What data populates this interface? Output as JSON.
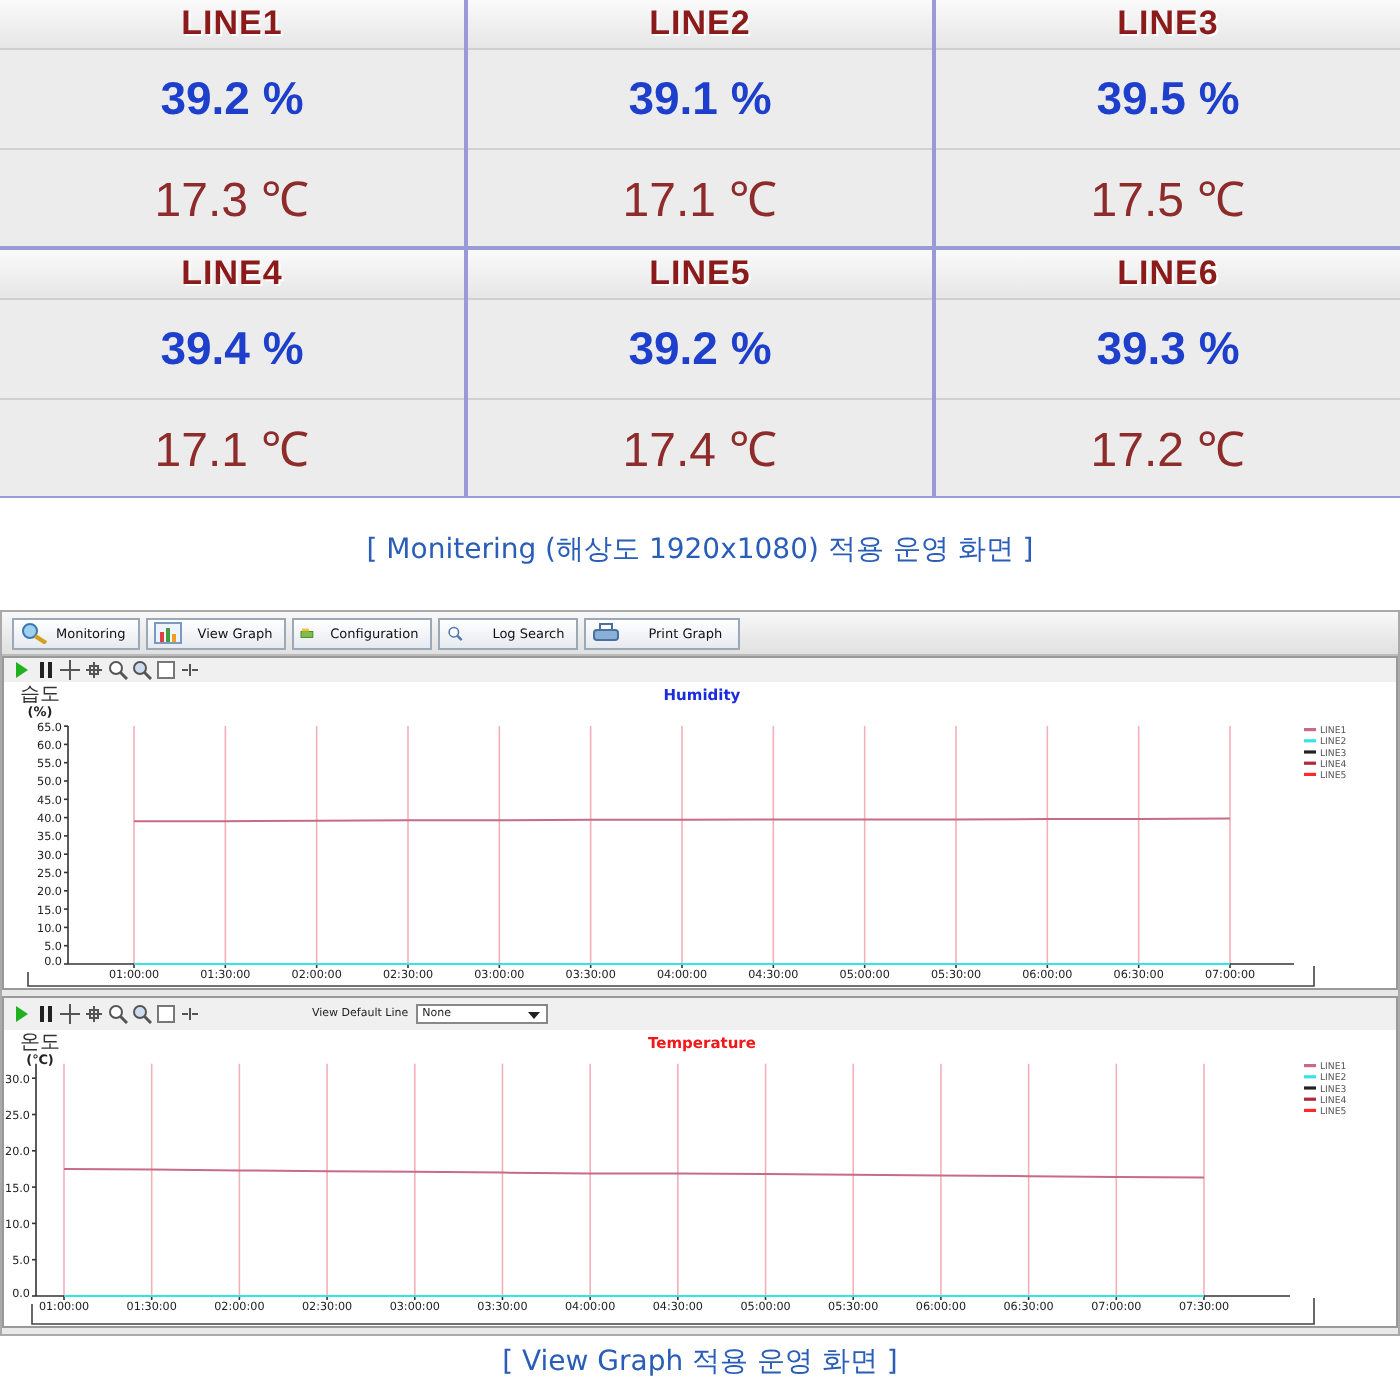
{
  "monitor": {
    "lines": [
      {
        "name": "LINE1",
        "humidity": "39.2 %",
        "temperature": "17.3 ℃"
      },
      {
        "name": "LINE2",
        "humidity": "39.1 %",
        "temperature": "17.1 ℃"
      },
      {
        "name": "LINE3",
        "humidity": "39.5 %",
        "temperature": "17.5 ℃"
      },
      {
        "name": "LINE4",
        "humidity": "39.4 %",
        "temperature": "17.1 ℃"
      },
      {
        "name": "LINE5",
        "humidity": "39.2 %",
        "temperature": "17.4 ℃"
      },
      {
        "name": "LINE6",
        "humidity": "39.3 %",
        "temperature": "17.2 ℃"
      }
    ]
  },
  "caption_1": "[ Monitering (해상도 1920x1080) 적용 운영 화면 ]",
  "app": {
    "toolbar": [
      {
        "label": "Monitoring"
      },
      {
        "label": "View Graph"
      },
      {
        "label": "Configuration"
      },
      {
        "label": "Log Search"
      },
      {
        "label": "Print Graph"
      }
    ],
    "graphs": [
      {
        "kind": "humidity",
        "y_label": "습도",
        "y_unit": "(%)",
        "chart_data": {
          "type": "line",
          "title": "Humidity",
          "categories": [
            "01:00:00",
            "01:30:00",
            "02:00:00",
            "02:30:00",
            "03:00:00",
            "03:30:00",
            "04:00:00",
            "04:30:00",
            "05:00:00",
            "05:30:00",
            "06:00:00",
            "06:30:00",
            "07:00:00"
          ],
          "ylim": [
            0,
            65
          ],
          "yticks": [
            {
              "value": 0,
              "label": "0.0"
            },
            {
              "value": 5,
              "label": "5.0"
            },
            {
              "value": 10,
              "label": "10.0"
            },
            {
              "value": 15,
              "label": "15.0"
            },
            {
              "value": 20,
              "label": "20.0"
            },
            {
              "value": 25,
              "label": "25.0"
            },
            {
              "value": 30,
              "label": "30.0"
            },
            {
              "value": 35,
              "label": "35.0"
            },
            {
              "value": 40,
              "label": "40.0"
            },
            {
              "value": 45,
              "label": "45.0"
            },
            {
              "value": 50,
              "label": "50.0"
            },
            {
              "value": 55,
              "label": "55.0"
            },
            {
              "value": 60,
              "label": "60.0"
            },
            {
              "value": 65,
              "label": "65.0"
            }
          ],
          "series": [
            {
              "name": "LINE1",
              "color": "#c86a8a",
              "values": [
                39.0,
                39.0,
                39.1,
                39.3,
                39.3,
                39.4,
                39.4,
                39.5,
                39.5,
                39.5,
                39.6,
                39.6,
                39.8
              ]
            },
            {
              "name": "LINE2",
              "color": "#33e6e6",
              "values": [
                0,
                0,
                0,
                0,
                0,
                0,
                0,
                0,
                0,
                0,
                0,
                0,
                0
              ]
            },
            {
              "name": "LINE3",
              "color": "#222222",
              "values": [
                null,
                null,
                null,
                null,
                null,
                null,
                null,
                null,
                null,
                null,
                null,
                null,
                null
              ]
            },
            {
              "name": "LINE4",
              "color": "#b02a3a",
              "values": [
                null,
                null,
                null,
                null,
                null,
                null,
                null,
                null,
                null,
                null,
                null,
                null,
                null
              ]
            },
            {
              "name": "LINE5",
              "color": "#ff2a2a",
              "values": [
                null,
                null,
                null,
                null,
                null,
                null,
                null,
                null,
                null,
                null,
                null,
                null,
                null
              ]
            }
          ],
          "grid": true,
          "legend": true
        }
      },
      {
        "kind": "temperature",
        "y_label": "온도",
        "y_unit": "(℃)",
        "view_default_line": {
          "label": "View Default Line",
          "value": "None"
        },
        "chart_data": {
          "type": "line",
          "title": "Temperature",
          "categories": [
            "01:00:00",
            "01:30:00",
            "02:00:00",
            "02:30:00",
            "03:00:00",
            "03:30:00",
            "04:00:00",
            "04:30:00",
            "05:00:00",
            "05:30:00",
            "06:00:00",
            "06:30:00",
            "07:00:00",
            "07:30:00"
          ],
          "ylim": [
            0,
            32
          ],
          "yticks": [
            {
              "value": 0,
              "label": "0.0"
            },
            {
              "value": 5,
              "label": "5.0"
            },
            {
              "value": 10,
              "label": "10.0"
            },
            {
              "value": 15,
              "label": "15.0"
            },
            {
              "value": 20,
              "label": "20.0"
            },
            {
              "value": 25,
              "label": "25.0"
            },
            {
              "value": 30,
              "label": "30.0"
            }
          ],
          "series": [
            {
              "name": "LINE1",
              "color": "#c86a8a",
              "values": [
                17.5,
                17.4,
                17.3,
                17.2,
                17.1,
                17.0,
                16.9,
                16.9,
                16.8,
                16.7,
                16.6,
                16.5,
                16.4,
                16.3
              ]
            },
            {
              "name": "LINE2",
              "color": "#33e6e6",
              "values": [
                0,
                0,
                0,
                0,
                0,
                0,
                0,
                0,
                0,
                0,
                0,
                0,
                0,
                0
              ]
            },
            {
              "name": "LINE3",
              "color": "#222222",
              "values": [
                null,
                null,
                null,
                null,
                null,
                null,
                null,
                null,
                null,
                null,
                null,
                null,
                null,
                null
              ]
            },
            {
              "name": "LINE4",
              "color": "#b02a3a",
              "values": [
                null,
                null,
                null,
                null,
                null,
                null,
                null,
                null,
                null,
                null,
                null,
                null,
                null,
                null
              ]
            },
            {
              "name": "LINE5",
              "color": "#ff2a2a",
              "values": [
                null,
                null,
                null,
                null,
                null,
                null,
                null,
                null,
                null,
                null,
                null,
                null,
                null,
                null
              ]
            }
          ],
          "grid": true,
          "legend": true
        }
      }
    ]
  },
  "caption_2": "[ View Graph 적용 운영 화면 ]"
}
